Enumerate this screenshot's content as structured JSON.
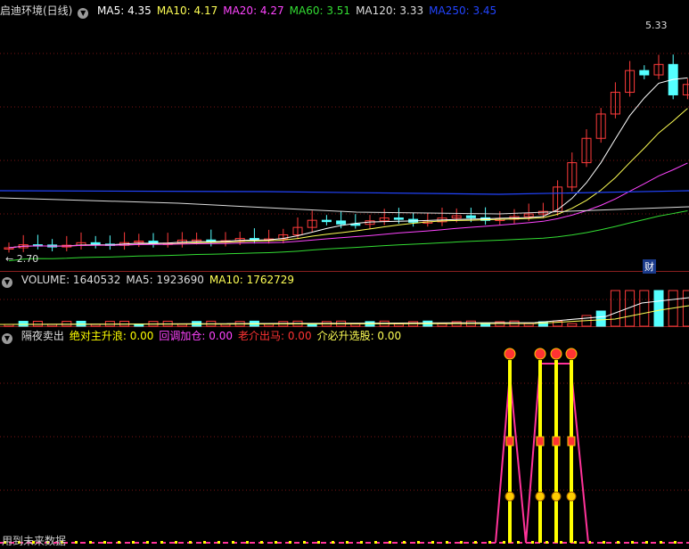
{
  "panel1": {
    "stock_name": "启迪环境(日线)",
    "items": [
      {
        "label": "MA5: 4.35",
        "color": "#ffffff"
      },
      {
        "label": "MA10: 4.17",
        "color": "#ffff55"
      },
      {
        "label": "MA20: 4.27",
        "color": "#ff44ff"
      },
      {
        "label": "MA60: 3.51",
        "color": "#33dd33"
      },
      {
        "label": "MA120: 3.33",
        "color": "#dddddd"
      },
      {
        "label": "MA250: 3.45",
        "color": "#2244ff"
      }
    ],
    "high_label": "5.33",
    "low_label": "← 2.70",
    "badge": "财"
  },
  "panel2": {
    "items": [
      {
        "label": "VOLUME: 1640532",
        "color": "#dddddd"
      },
      {
        "label": "MA5: 1923690",
        "color": "#dddddd"
      },
      {
        "label": "MA10: 1762729",
        "color": "#ffff55"
      }
    ]
  },
  "panel3": {
    "items": [
      {
        "label": "隔夜卖出",
        "color": "#dddddd"
      },
      {
        "label": "绝对主升浪: 0.00",
        "color": "#ffff00"
      },
      {
        "label": "回调加仓: 0.00",
        "color": "#ff44ff"
      },
      {
        "label": "老介出马: 0.00",
        "color": "#ff3333"
      },
      {
        "label": "介必升选股: 0.00",
        "color": "#ffff55"
      }
    ],
    "footer": "用到未来数据"
  },
  "colors": {
    "up": "#ff3b3b",
    "down": "#54ffff",
    "grid": "#7a1515"
  }
}
